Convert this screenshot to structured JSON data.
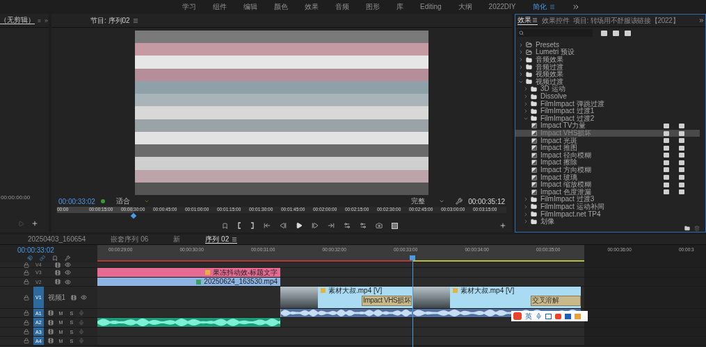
{
  "workspace_bar": {
    "tabs": [
      {
        "label": "学习",
        "selected": false
      },
      {
        "label": "组件",
        "selected": false
      },
      {
        "label": "编辑",
        "selected": false
      },
      {
        "label": "颜色",
        "selected": false
      },
      {
        "label": "效果",
        "selected": false
      },
      {
        "label": "音频",
        "selected": false
      },
      {
        "label": "图形",
        "selected": false
      },
      {
        "label": "库",
        "selected": false
      },
      {
        "label": "Editing",
        "selected": false
      },
      {
        "label": "大纲",
        "selected": false
      },
      {
        "label": "2022DIY",
        "selected": false
      },
      {
        "label": "简化",
        "selected": true
      }
    ]
  },
  "source_panel": {
    "tab": "（无剪辑）",
    "timecode": "00:00:00:00"
  },
  "program_monitor": {
    "tab": "节目: 序列02",
    "timecode": "00:00:33:02",
    "zoom": "适合",
    "quality": "完整",
    "duration": "00:00:35:12",
    "level": 0.17,
    "ruler": [
      "00:00",
      "00:00:15:00",
      "00:00:30:00",
      "00:00:45:00",
      "00:01:00:00",
      "00:01:15:00",
      "00:01:30:00",
      "00:01:45:00",
      "00:02:00:00",
      "00:02:15:00",
      "00:02:30:00",
      "00:02:45:00",
      "00:03:00:00",
      "00:03:15:00"
    ]
  },
  "effects_panel": {
    "tabs": [
      {
        "label": "效果",
        "selected": true
      },
      {
        "label": "效果控件",
        "selected": false
      },
      {
        "label": "项目: 转场用不舒服该链接【2022】",
        "selected": false
      }
    ],
    "tree": [
      {
        "label": "Presets",
        "kind": "preset_folder",
        "expanded": false,
        "selected": false
      },
      {
        "label": "Lumetri 预设",
        "kind": "preset_folder",
        "expanded": false,
        "selected": false
      },
      {
        "label": "音频效果",
        "kind": "folder",
        "expanded": false,
        "selected": false
      },
      {
        "label": "音频过渡",
        "kind": "folder",
        "expanded": false,
        "selected": false
      },
      {
        "label": "视频效果",
        "kind": "folder",
        "expanded": false,
        "selected": false
      },
      {
        "label": "视频过渡",
        "kind": "folder",
        "expanded": true,
        "selected": false,
        "children": [
          {
            "label": "3D 运动",
            "kind": "folder",
            "expanded": false,
            "selected": false
          },
          {
            "label": "Dissolve",
            "kind": "folder",
            "expanded": false,
            "selected": false
          },
          {
            "label": "FilmImpact 弹跳过渡",
            "kind": "folder",
            "expanded": false,
            "selected": false
          },
          {
            "label": "FilmImpact 过渡1",
            "kind": "folder",
            "expanded": false,
            "selected": false
          },
          {
            "label": "FilmImpact 过渡2",
            "kind": "folder",
            "expanded": true,
            "selected": false,
            "children": [
              {
                "label": "Impact TV力量",
                "kind": "effect",
                "selected": false
              },
              {
                "label": "Impact VHS损坏",
                "kind": "effect",
                "selected": true
              },
              {
                "label": "Impact 光斑",
                "kind": "effect",
                "selected": false
              },
              {
                "label": "Impact 推图",
                "kind": "effect",
                "selected": false
              },
              {
                "label": "Impact 径向模糊",
                "kind": "effect",
                "selected": false
              },
              {
                "label": "Impact 擦除",
                "kind": "effect",
                "selected": false
              },
              {
                "label": "Impact 方向模糊",
                "kind": "effect",
                "selected": false
              },
              {
                "label": "Impact 玻璃",
                "kind": "effect",
                "selected": false
              },
              {
                "label": "Impact 缩放模糊",
                "kind": "effect",
                "selected": false
              },
              {
                "label": "Impact 色度泄漏",
                "kind": "effect",
                "selected": false
              }
            ]
          },
          {
            "label": "FilmImpact 过渡3",
            "kind": "folder",
            "expanded": false,
            "selected": false
          },
          {
            "label": "FilmImpact 运动补间",
            "kind": "folder",
            "expanded": false,
            "selected": false
          },
          {
            "label": "FilmImpact.net TP4",
            "kind": "folder",
            "expanded": false,
            "selected": false
          },
          {
            "label": "划像",
            "kind": "folder",
            "expanded": false,
            "selected": false
          }
        ]
      }
    ]
  },
  "timeline": {
    "tabs": [
      {
        "label": "20250403_160654",
        "selected": false
      },
      {
        "label": "嵌套序列 06",
        "selected": false
      },
      {
        "label": "新",
        "selected": false
      },
      {
        "label": "序列 02",
        "selected": true
      }
    ],
    "timecode": "00:00:33:02",
    "ruler": [
      "00:00:29:00",
      "00:00:30:00",
      "00:00:31:00",
      "00:00:32:00",
      "00:00:33:00",
      "00:00:34:00",
      "00:00:35:00",
      "00:00:36:00",
      "00:00:3"
    ],
    "tracks": [
      {
        "name": "V4",
        "kind": "video",
        "targeted": false
      },
      {
        "name": "V3",
        "kind": "video",
        "targeted": false,
        "clips": [
          {
            "label": "果冻抖动效-标题文字",
            "kind": "title"
          }
        ]
      },
      {
        "name": "V2",
        "kind": "video",
        "targeted": false,
        "clips": [
          {
            "label": "20250624_163530.mp4",
            "kind": "nested"
          }
        ]
      },
      {
        "name": "V1",
        "kind": "video",
        "targeted": true,
        "title": "视频1",
        "clips": [
          {
            "label": "素材大叔.mp4 [V]",
            "kind": "video"
          },
          {
            "label": "Impact VHS损坏",
            "kind": "transition"
          },
          {
            "label": "素材大叔.mp4 [V]",
            "kind": "video"
          },
          {
            "label": "交叉溶解",
            "kind": "transition"
          }
        ]
      },
      {
        "name": "A1",
        "kind": "audio",
        "targeted": true,
        "mute": "M",
        "solo": "S",
        "clips": [
          {
            "kind": "audio"
          },
          {
            "kind": "audio"
          }
        ]
      },
      {
        "name": "A2",
        "kind": "audio",
        "targeted": true,
        "mute": "M",
        "solo": "S",
        "clips": [
          {
            "kind": "music"
          }
        ]
      },
      {
        "name": "A3",
        "kind": "audio",
        "targeted": true,
        "mute": "M",
        "solo": "S"
      },
      {
        "name": "A4",
        "kind": "audio",
        "targeted": true,
        "mute": "M",
        "solo": "S"
      }
    ]
  },
  "ime_toolbar": {
    "mode": "英"
  }
}
